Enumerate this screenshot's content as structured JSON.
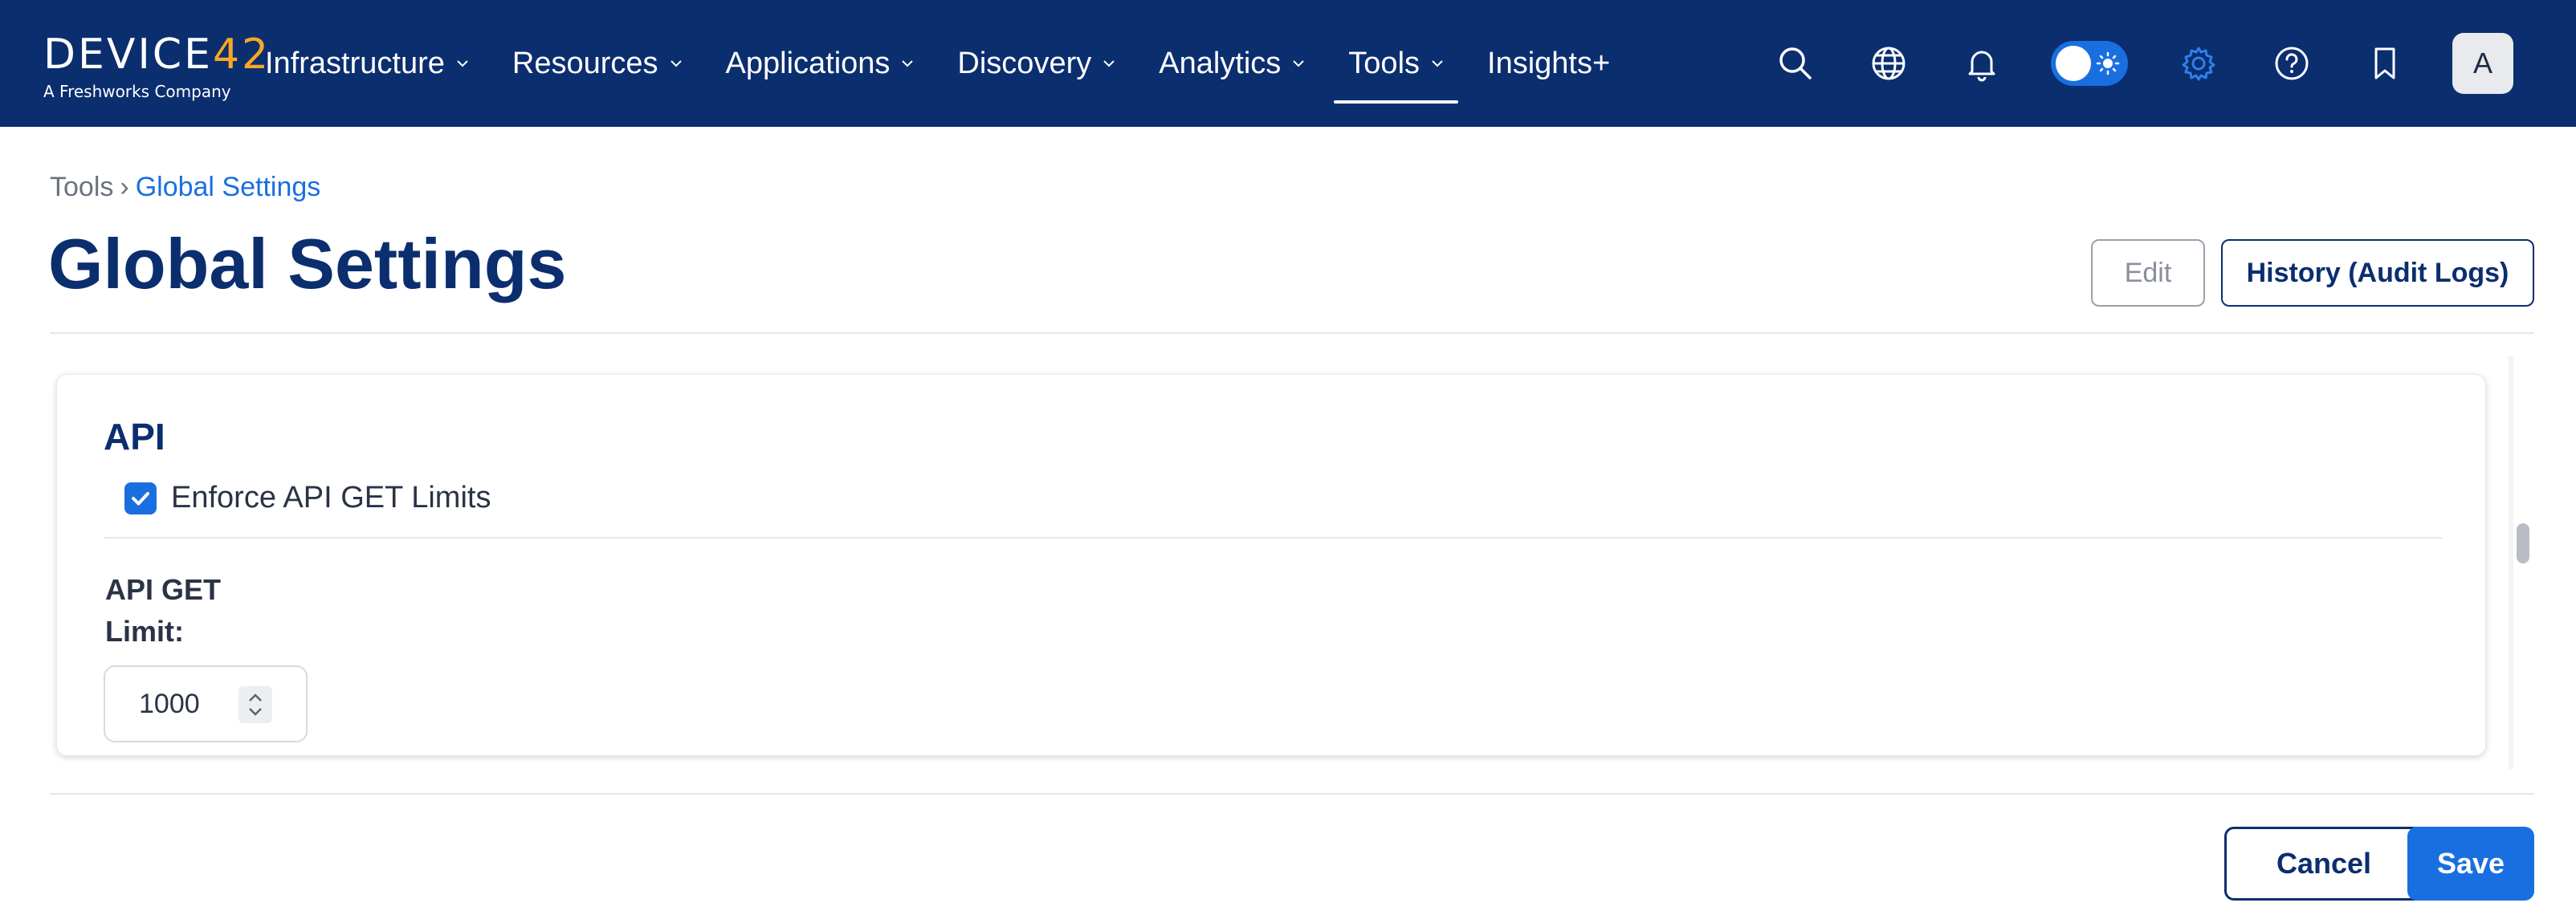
{
  "app": {
    "logo_main": "DEVICE",
    "logo_accent": "42",
    "logo_sub": "A Freshworks Company"
  },
  "nav": {
    "items": [
      {
        "label": "Infrastructure",
        "has_menu": true
      },
      {
        "label": "Resources",
        "has_menu": true
      },
      {
        "label": "Applications",
        "has_menu": true
      },
      {
        "label": "Discovery",
        "has_menu": true
      },
      {
        "label": "Analytics",
        "has_menu": true
      },
      {
        "label": "Tools",
        "has_menu": true,
        "active": true
      },
      {
        "label": "Insights+",
        "has_menu": false
      }
    ],
    "icons": [
      "search-icon",
      "globe-icon",
      "bell-icon",
      "theme-toggle",
      "gear-icon",
      "help-icon",
      "bookmark-icon"
    ],
    "avatar_initial": "A"
  },
  "breadcrumb": {
    "parent": "Tools",
    "separator": "›",
    "current": "Global Settings"
  },
  "page": {
    "title": "Global Settings",
    "edit_label": "Edit",
    "history_label": "History (Audit Logs)"
  },
  "api_section": {
    "title": "API",
    "enforce_label": "Enforce API GET Limits",
    "enforce_checked": true,
    "limit_label_line1": "API GET",
    "limit_label_line2": "Limit:",
    "limit_value": "1000"
  },
  "footer": {
    "cancel_label": "Cancel",
    "save_label": "Save"
  },
  "colors": {
    "nav_bg": "#0b2e6f",
    "accent": "#1a6fe0",
    "logo_accent": "#f7a823",
    "title": "#0b2e6f"
  }
}
